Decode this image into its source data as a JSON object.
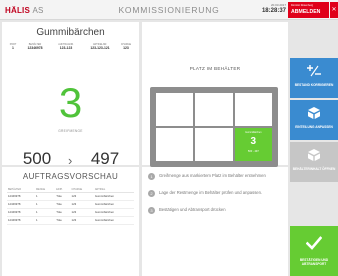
{
  "header": {
    "logo": "HÄLIS",
    "logo_sub": "AS",
    "title": "KOMMISSIONIERUNG",
    "date": "20.03.2017",
    "time": "18:28:37",
    "user": "Dominic Rosenberg",
    "logout_label": "ABMELDEN",
    "close_label": "✕"
  },
  "article": {
    "name": "Gummibärchen",
    "meta": [
      {
        "label": "PORT",
        "value": "1"
      },
      {
        "label": "BEHÄLTER",
        "value": "12346978"
      },
      {
        "label": "AUFTRAGNR.",
        "value": "123-123"
      },
      {
        "label": "ARTIKELNR.",
        "value": "123-123-121"
      },
      {
        "label": "CHARGE",
        "value": "123"
      }
    ],
    "pick_qty": "3",
    "pick_qty_label": "GREIFMENGE",
    "qty_current": "500",
    "qty_current_label": "MENGE AKTUELL",
    "qty_after": "497",
    "qty_after_label": "MENGE SOLL",
    "arrow": "›"
  },
  "bin": {
    "title": "PLATZ IM BEHÄLTER",
    "active_head": "Gummibärchen",
    "active_qty": "3",
    "active_sub": "500 - 497"
  },
  "preview": {
    "title": "AUFTRAGSVORSCHAU",
    "columns": [
      "BEHÄLTER",
      "MENGE",
      "EINH.",
      "CHARGE",
      "ARTIKEL"
    ],
    "rows": [
      [
        "12346978",
        "1",
        "Tüte",
        "123",
        "Gummibärchen"
      ],
      [
        "12346978",
        "1",
        "Tüte",
        "123",
        "Gummibärchen"
      ],
      [
        "12346978",
        "1",
        "Tüte",
        "123",
        "Gummibärchen"
      ],
      [
        "12346978",
        "1",
        "Tüte",
        "123",
        "Gummibärchen"
      ]
    ]
  },
  "steps": [
    {
      "num": "1",
      "text": "Greifmenge aus markiertem Platz im Behälter entnehmen"
    },
    {
      "num": "2",
      "text": "Lage der Restmenge im Behälter prüfen und anpassen."
    },
    {
      "num": "3",
      "text": "Bestätigen und Abtransport drücken"
    }
  ],
  "side_buttons": {
    "stock_correct": "BESTAND KORRIGIEREN",
    "divide": "EINTEILUNG ANPASSEN",
    "special": "BEHÄLTERINHALT ÖFFNEN",
    "confirm": "BESTÄTIGEN UND ABTRANSPORT"
  },
  "colors": {
    "brand_red": "#e0001a",
    "accent_green": "#66cc33",
    "accent_blue": "#3a8bd0"
  }
}
